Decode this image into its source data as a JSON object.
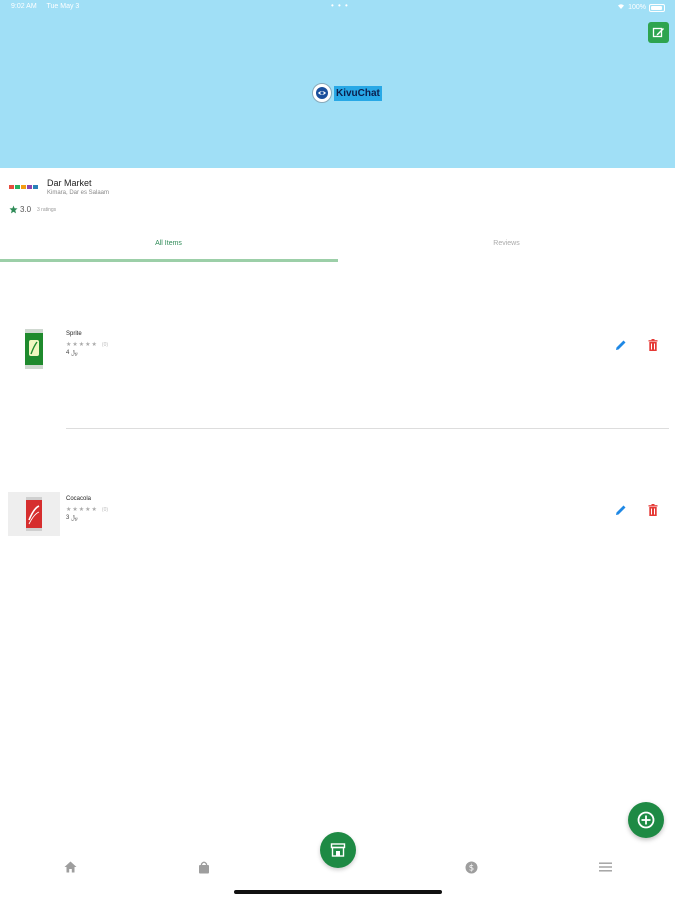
{
  "status_bar": {
    "time": "9:02 AM",
    "date": "Tue May 3",
    "dots": "• • •",
    "battery": "100%"
  },
  "header": {
    "logo_text": "KivuChat",
    "background": "#a0dff6"
  },
  "shop": {
    "name": "Dar Market",
    "location": "Kimara, Dar es Salaam",
    "rating": "3.0",
    "ratings_count": "3 ratings"
  },
  "tabs": [
    {
      "label": "All Items",
      "active": true
    },
    {
      "label": "Reviews",
      "active": false
    }
  ],
  "items": [
    {
      "name": "Sprite",
      "stars": "★★★★★",
      "count": "(0)",
      "price": "4 ﷼"
    },
    {
      "name": "Cocacola",
      "stars": "★★★★★",
      "count": "(0)",
      "price": "3 ﷼"
    }
  ],
  "bottom_nav": [
    {
      "icon": "home-icon"
    },
    {
      "icon": "shopping-bag-icon"
    },
    {
      "icon": "store-icon"
    },
    {
      "icon": "dollar-icon"
    },
    {
      "icon": "menu-icon"
    }
  ],
  "colors": {
    "accent_green": "#1e8a44",
    "edit_blue": "#1e88e5",
    "delete_red": "#e53935"
  }
}
